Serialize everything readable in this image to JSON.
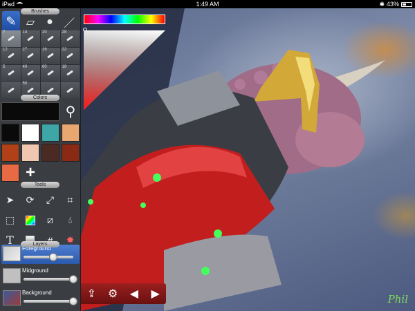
{
  "status_bar": {
    "device": "iPad",
    "time": "1:49 AM",
    "battery": "43%",
    "battery_level": 0.43
  },
  "panel": {
    "brushes_label": "Brushes",
    "colors_label": "Colors",
    "tools_label": "Tools",
    "layers_label": "Layers",
    "brush_sizes": [
      "7",
      "14",
      "20",
      "28",
      "12",
      "27",
      "16",
      "22",
      "5",
      "40",
      "60",
      "18",
      "",
      "50",
      "",
      ""
    ],
    "swatches": [
      "#0a0a0a",
      "#ffffff",
      "#3ea6a6",
      "#e8a670",
      "#b04018",
      "#f0c6b0",
      "#4a2a22",
      "#8a2a14",
      "#e86a44"
    ],
    "add_swatch_symbol": "+"
  },
  "tools": [
    "select-arrow",
    "rotate",
    "transform",
    "crop",
    "marquee",
    "gradient",
    "blend",
    "eyedropper",
    "text",
    "fill",
    "grid",
    "magic"
  ],
  "layers": [
    {
      "name": "Foreground",
      "opacity": 0.6,
      "selected": true
    },
    {
      "name": "Midground",
      "opacity": 1.0,
      "selected": false
    },
    {
      "name": "Background",
      "opacity": 1.0,
      "selected": false
    }
  ],
  "bottom_bar": {
    "share_icon": "share",
    "settings_icon": "gear",
    "undo_icon": "left-arrow",
    "redo_icon": "right-arrow"
  },
  "signature": "Phil"
}
